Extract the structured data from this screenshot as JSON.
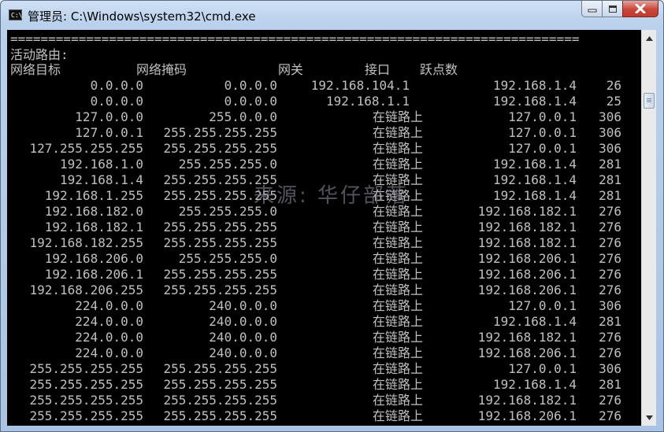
{
  "window": {
    "title": "管理员: C:\\Windows\\system32\\cmd.exe",
    "icon_text": "C:\\"
  },
  "console": {
    "separator": "===========================================================================",
    "section_title": "活动路由:",
    "headers": {
      "destination": "网络目标",
      "netmask": "网络掩码",
      "gateway": "网关",
      "interface": "接口",
      "metric": "跃点数"
    },
    "rows": [
      {
        "destination": "0.0.0.0",
        "netmask": "0.0.0.0",
        "gateway": "192.168.104.1",
        "interface": "192.168.1.4",
        "metric": "26"
      },
      {
        "destination": "0.0.0.0",
        "netmask": "0.0.0.0",
        "gateway": "192.168.1.1",
        "interface": "192.168.1.4",
        "metric": "25"
      },
      {
        "destination": "127.0.0.0",
        "netmask": "255.0.0.0",
        "gateway": "在链路上",
        "interface": "127.0.0.1",
        "metric": "306"
      },
      {
        "destination": "127.0.0.1",
        "netmask": "255.255.255.255",
        "gateway": "在链路上",
        "interface": "127.0.0.1",
        "metric": "306"
      },
      {
        "destination": "127.255.255.255",
        "netmask": "255.255.255.255",
        "gateway": "在链路上",
        "interface": "127.0.0.1",
        "metric": "306"
      },
      {
        "destination": "192.168.1.0",
        "netmask": "255.255.255.0",
        "gateway": "在链路上",
        "interface": "192.168.1.4",
        "metric": "281"
      },
      {
        "destination": "192.168.1.4",
        "netmask": "255.255.255.255",
        "gateway": "在链路上",
        "interface": "192.168.1.4",
        "metric": "281"
      },
      {
        "destination": "192.168.1.255",
        "netmask": "255.255.255.255",
        "gateway": "在链路上",
        "interface": "192.168.1.4",
        "metric": "281"
      },
      {
        "destination": "192.168.182.0",
        "netmask": "255.255.255.0",
        "gateway": "在链路上",
        "interface": "192.168.182.1",
        "metric": "276"
      },
      {
        "destination": "192.168.182.1",
        "netmask": "255.255.255.255",
        "gateway": "在链路上",
        "interface": "192.168.182.1",
        "metric": "276"
      },
      {
        "destination": "192.168.182.255",
        "netmask": "255.255.255.255",
        "gateway": "在链路上",
        "interface": "192.168.182.1",
        "metric": "276"
      },
      {
        "destination": "192.168.206.0",
        "netmask": "255.255.255.0",
        "gateway": "在链路上",
        "interface": "192.168.206.1",
        "metric": "276"
      },
      {
        "destination": "192.168.206.1",
        "netmask": "255.255.255.255",
        "gateway": "在链路上",
        "interface": "192.168.206.1",
        "metric": "276"
      },
      {
        "destination": "192.168.206.255",
        "netmask": "255.255.255.255",
        "gateway": "在链路上",
        "interface": "192.168.206.1",
        "metric": "276"
      },
      {
        "destination": "224.0.0.0",
        "netmask": "240.0.0.0",
        "gateway": "在链路上",
        "interface": "127.0.0.1",
        "metric": "306"
      },
      {
        "destination": "224.0.0.0",
        "netmask": "240.0.0.0",
        "gateway": "在链路上",
        "interface": "192.168.1.4",
        "metric": "281"
      },
      {
        "destination": "224.0.0.0",
        "netmask": "240.0.0.0",
        "gateway": "在链路上",
        "interface": "192.168.182.1",
        "metric": "276"
      },
      {
        "destination": "224.0.0.0",
        "netmask": "240.0.0.0",
        "gateway": "在链路上",
        "interface": "192.168.206.1",
        "metric": "276"
      },
      {
        "destination": "255.255.255.255",
        "netmask": "255.255.255.255",
        "gateway": "在链路上",
        "interface": "127.0.0.1",
        "metric": "306"
      },
      {
        "destination": "255.255.255.255",
        "netmask": "255.255.255.255",
        "gateway": "在链路上",
        "interface": "192.168.1.4",
        "metric": "281"
      },
      {
        "destination": "255.255.255.255",
        "netmask": "255.255.255.255",
        "gateway": "在链路上",
        "interface": "192.168.182.1",
        "metric": "276"
      },
      {
        "destination": "255.255.255.255",
        "netmask": "255.255.255.255",
        "gateway": "在链路上",
        "interface": "192.168.206.1",
        "metric": "276"
      }
    ],
    "watermark": "来源: 华仔部落"
  },
  "colors": {
    "console_bg": "#000000",
    "console_text": "#c0c0c0",
    "title_bar": "#b9d1ec",
    "close_button": "#c9453a"
  }
}
